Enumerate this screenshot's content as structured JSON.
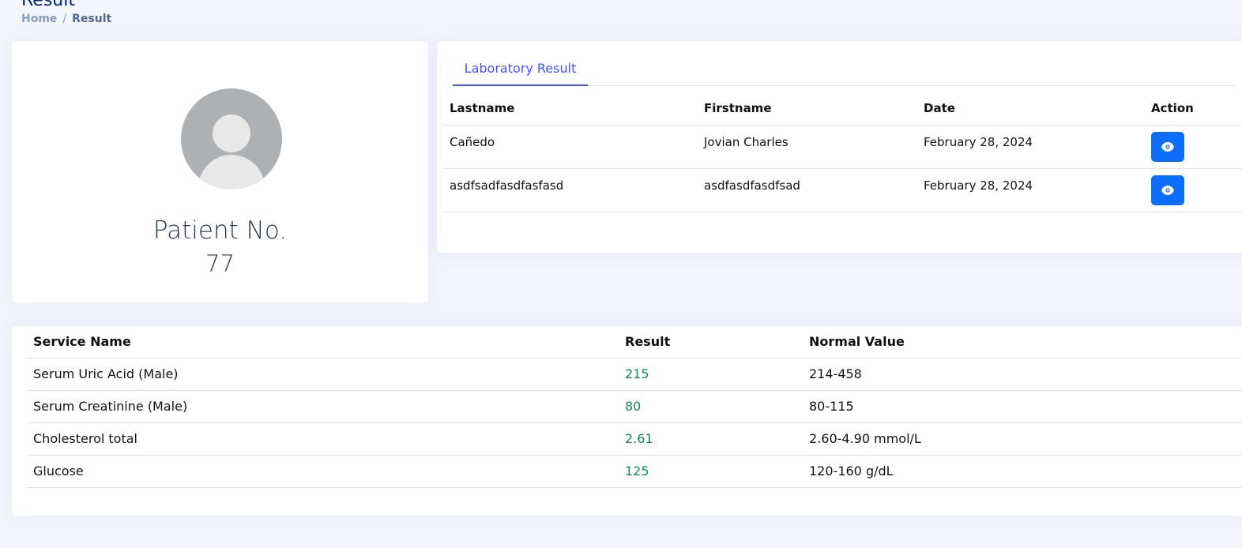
{
  "header": {
    "title": "Result",
    "breadcrumb": {
      "home": "Home",
      "separator": "/",
      "current": "Result"
    }
  },
  "profile": {
    "label": "Patient No.",
    "number": "77"
  },
  "lab": {
    "tab_label": "Laboratory Result",
    "columns": [
      "Lastname",
      "Firstname",
      "Date",
      "Action"
    ],
    "rows": [
      {
        "lastname": "Cañedo",
        "firstname": "Jovian Charles",
        "date": "February 28, 2024",
        "action_icon": "eye-icon"
      },
      {
        "lastname": "asdfsadfasdfasfasd",
        "firstname": "asdfasdfasdfsad",
        "date": "February 28, 2024",
        "action_icon": "eye-icon"
      }
    ]
  },
  "results": {
    "columns": [
      "Service Name",
      "Result",
      "Normal Value"
    ],
    "rows": [
      {
        "service": "Serum Uric Acid (Male)",
        "result": "215",
        "normal": "214-458"
      },
      {
        "service": "Serum Creatinine (Male)",
        "result": "80",
        "normal": "80-115"
      },
      {
        "service": "Cholesterol total",
        "result": "2.61",
        "normal": "2.60-4.90 mmol/L"
      },
      {
        "service": "Glucose",
        "result": "125",
        "normal": "120-160 g/dL"
      }
    ]
  },
  "colors": {
    "accent": "#4154f1",
    "button": "#0d6efd",
    "result_text": "#198754",
    "title": "#012970"
  }
}
